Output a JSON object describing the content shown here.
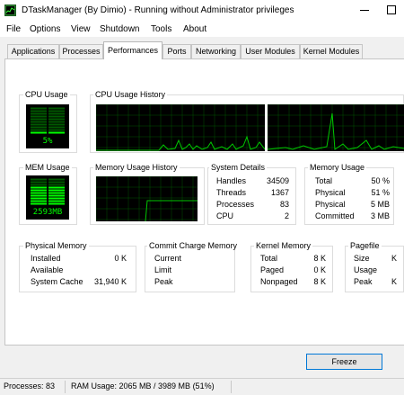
{
  "window": {
    "title": "DTaskManager (By Dimio) - Running without Administrator privileges"
  },
  "menu": [
    "File",
    "Options",
    "View",
    "Shutdown",
    "Tools",
    "About"
  ],
  "tabs": [
    {
      "label": "Applications",
      "active": false
    },
    {
      "label": "Processes",
      "active": false
    },
    {
      "label": "Performances",
      "active": true
    },
    {
      "label": "Ports",
      "active": false
    },
    {
      "label": "Networking",
      "active": false
    },
    {
      "label": "User Modules",
      "active": false
    },
    {
      "label": "Kernel Modules",
      "active": false
    }
  ],
  "cpu_usage": {
    "label": "CPU Usage",
    "value": "5%",
    "level": 0.05
  },
  "cpu_history": {
    "label": "CPU Usage History"
  },
  "mem_usage": {
    "label": "MEM Usage",
    "value": "2593MB",
    "level": 0.65
  },
  "mem_history": {
    "label": "Memory Usage History"
  },
  "system_details": {
    "label": "System Details",
    "rows": [
      {
        "name": "Handles",
        "value": "34509"
      },
      {
        "name": "Threads",
        "value": "1367"
      },
      {
        "name": "Processes",
        "value": "83"
      },
      {
        "name": "CPU",
        "value": "2"
      }
    ]
  },
  "memory_usage": {
    "label": "Memory Usage",
    "rows": [
      {
        "name": "Total",
        "value": "50 %"
      },
      {
        "name": "Physical",
        "value": "51 %"
      },
      {
        "name": "Physical",
        "value": "5 MB"
      },
      {
        "name": "Committed",
        "value": "3 MB"
      }
    ]
  },
  "physical_memory": {
    "label": "Physical Memory",
    "rows": [
      {
        "name": "Installed",
        "value": "0 K"
      },
      {
        "name": "Available",
        "value": ""
      },
      {
        "name": "System Cache",
        "value": "31,940 K"
      }
    ]
  },
  "commit_charge": {
    "label": "Commit Charge Memory",
    "rows": [
      {
        "name": "Current",
        "value": ""
      },
      {
        "name": "Limit",
        "value": ""
      },
      {
        "name": "Peak",
        "value": ""
      }
    ]
  },
  "kernel_memory": {
    "label": "Kernel Memory",
    "rows": [
      {
        "name": "Total",
        "value": "8 K"
      },
      {
        "name": "Paged",
        "value": "0 K"
      },
      {
        "name": "Nonpaged",
        "value": "8 K"
      }
    ]
  },
  "pagefile": {
    "label": "Pagefile",
    "rows": [
      {
        "name": "Size",
        "value": "K"
      },
      {
        "name": "Usage",
        "value": ""
      },
      {
        "name": "Peak",
        "value": "K"
      }
    ]
  },
  "freeze_button": "Freeze",
  "status": {
    "processes": "Processes: 83",
    "ram": "RAM Usage:  2065 MB / 3989 MB (51%)"
  },
  "colors": {
    "graph_line": "#00c800",
    "grid": "#006400"
  }
}
